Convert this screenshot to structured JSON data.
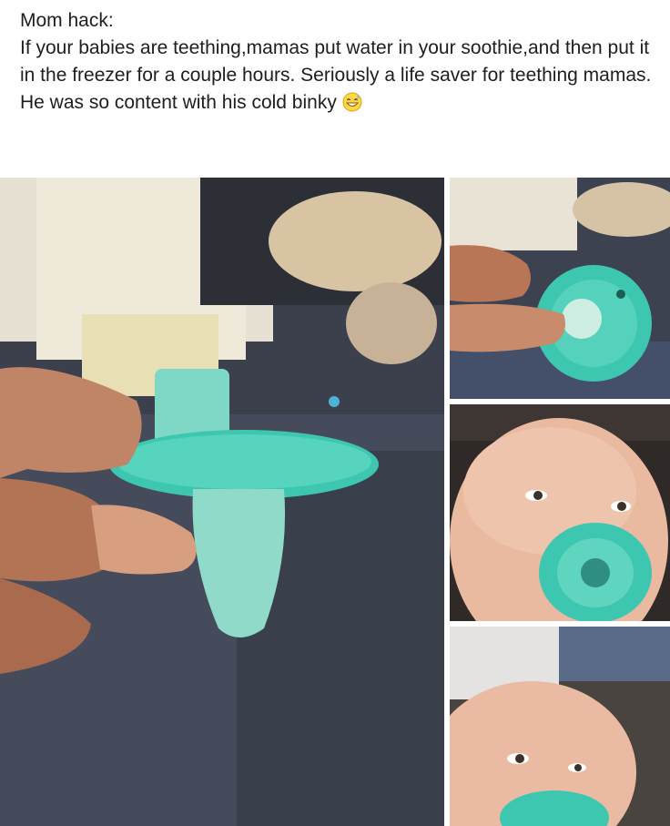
{
  "post": {
    "title": "Mom hack:",
    "body": "If your babies are teething,mamas put water in your soothie,and then put it in the freezer for a couple hours. Seriously a life saver for teething mamas. He was so content with his cold binky",
    "emoji": "grinning-face-with-sweat-icon"
  },
  "photos": [
    {
      "name": "frozen-pacifier-closeup",
      "subject": "hand holding frozen teal pacifier"
    },
    {
      "name": "pacifier-front-view",
      "subject": "fingers holding pacifier shield"
    },
    {
      "name": "baby-with-pacifier-1",
      "subject": "baby with teal pacifier"
    },
    {
      "name": "baby-with-pacifier-2",
      "subject": "baby with teal pacifier"
    }
  ],
  "colors": {
    "text": "#1c1e21",
    "pacifier": "#3ec7b0",
    "skin": "#e7b8a1",
    "floor": "#3a3f4a"
  }
}
